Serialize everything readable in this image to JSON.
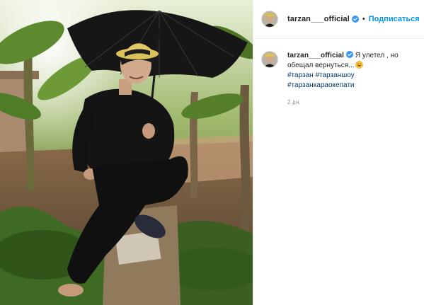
{
  "post": {
    "username": "tarzan___official",
    "verified": true,
    "follow_label": "Подписаться",
    "separator": "•",
    "caption": {
      "text_line1": "Я улетел , но",
      "text_line2": "обещал вернуться...",
      "emoji": "grinning-face-emoji",
      "hashtags": [
        "#тарзан",
        "#тарзаншоу",
        "#тарзанкараокепати"
      ]
    },
    "timestamp": "2 дн."
  },
  "colors": {
    "link_blue": "#0095f6",
    "hashtag_blue": "#00376b",
    "verified_blue": "#3897f0",
    "muted_gray": "#8e8e8e",
    "border": "#efefef"
  },
  "icons": {
    "verified": "verified-badge-icon",
    "avatar": "profile-avatar"
  }
}
